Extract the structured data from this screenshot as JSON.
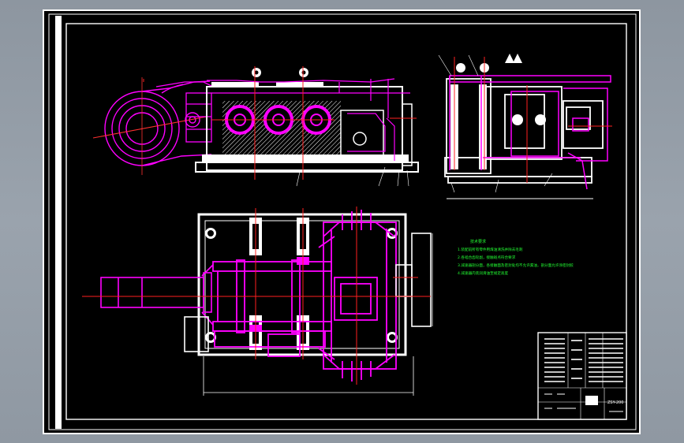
{
  "drawing": {
    "colors": {
      "paper": "#000000",
      "frame": "#ffffff",
      "part": "#ff00ff",
      "centerline": "#ff2020",
      "notes": "#22ff33",
      "background": "#949ca6"
    }
  },
  "notes": {
    "title": "技术要求",
    "lines": [
      "1.装配前所有零件用煤油清洗并除去毛刺",
      "2.各啮合齿轮副，接触斑点符合要求",
      "3.减速器剖分面，各接触面及密封处均不允许漏油，剖分面允许涂密封胶",
      "4.减速器内装润滑油至规定高度"
    ]
  },
  "title_block": {
    "drawing_no": "ZSY-200"
  }
}
